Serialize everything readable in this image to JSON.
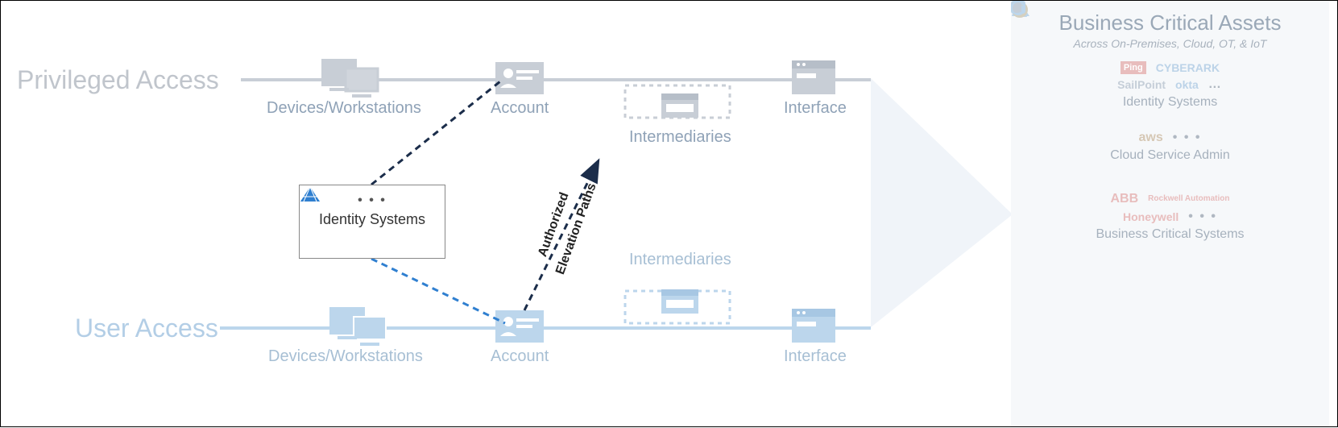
{
  "rows": {
    "privileged": "Privileged Access",
    "user": "User Access"
  },
  "nodes": {
    "devices": "Devices/Workstations",
    "account": "Account",
    "intermediaries": "Intermediaries",
    "interface": "Interface"
  },
  "identity_box": {
    "title": "Identity Systems",
    "ellipsis": "• • •"
  },
  "elevation": {
    "line1": "Authorized",
    "line2": "Elevation Paths"
  },
  "assets": {
    "title": "Business Critical Assets",
    "subtitle": "Across On-Premises, Cloud, OT, & IoT",
    "groups": {
      "identity": {
        "label": "Identity Systems",
        "brands": [
          "Ping",
          "CYBERARK",
          "SailPoint",
          "okta"
        ],
        "ellipsis": "…"
      },
      "cloud": {
        "label": "Cloud Service Admin",
        "brands": [
          "aws"
        ],
        "ellipsis": "• • •"
      },
      "bcs": {
        "label": "Business Critical Systems",
        "brands": [
          "ABB",
          "Rockwell Automation",
          "Honeywell"
        ],
        "ellipsis": "• • •"
      }
    }
  }
}
